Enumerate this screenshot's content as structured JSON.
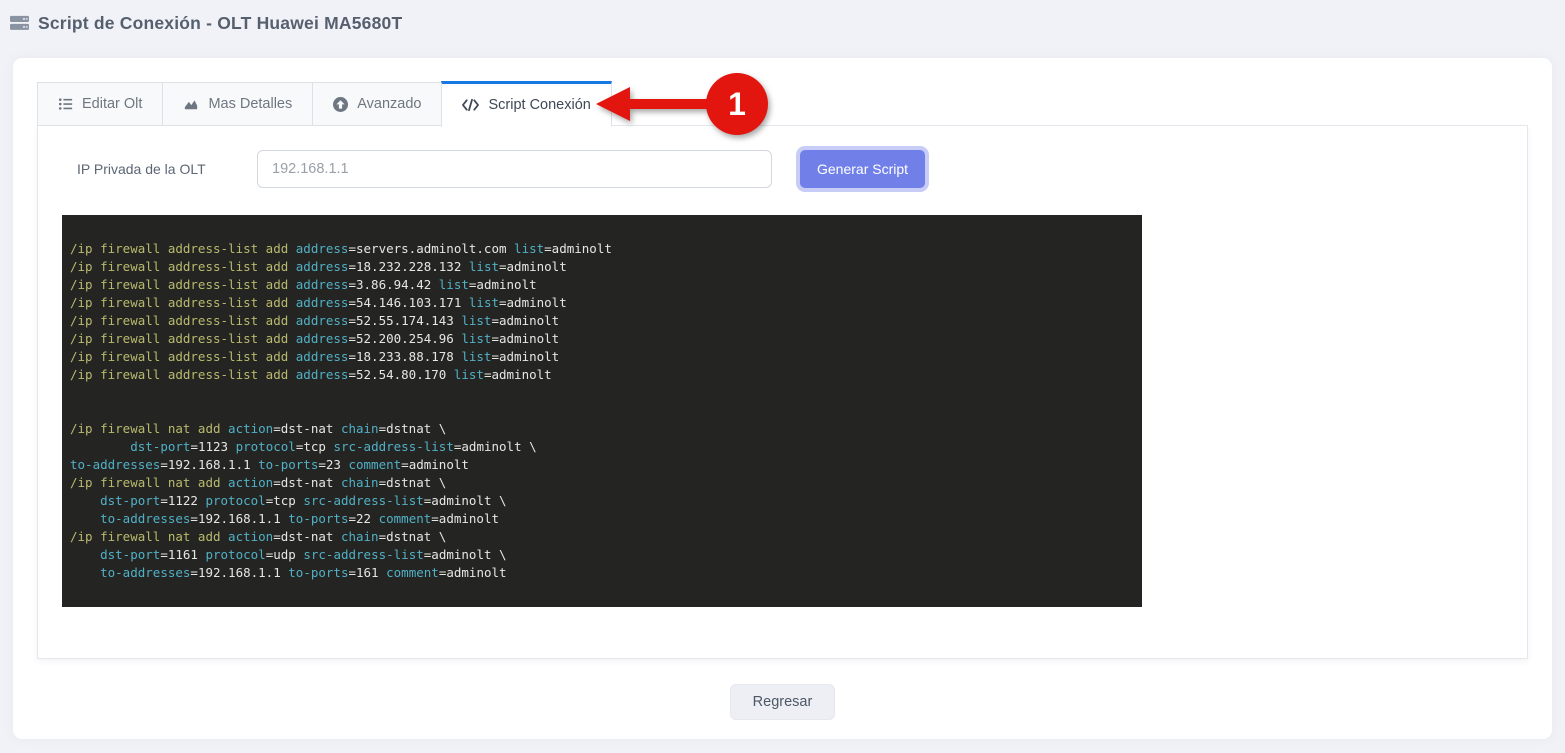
{
  "header": {
    "title": "Script de Conexión - OLT Huawei MA5680T",
    "icon": "server-icon"
  },
  "tabs": [
    {
      "label": "Editar Olt",
      "icon": "list-icon",
      "active": false
    },
    {
      "label": "Mas Detalles",
      "icon": "chart-area-icon",
      "active": false
    },
    {
      "label": "Avanzado",
      "icon": "arrow-up-circle-icon",
      "active": false
    },
    {
      "label": "Script Conexión",
      "icon": "code-icon",
      "active": true
    }
  ],
  "annotation": {
    "step_number": "1"
  },
  "form": {
    "ip_label": "IP Privada de la OLT",
    "ip_value": "192.168.1.1",
    "generate_button_label": "Generar Script"
  },
  "script_output": {
    "lines": [
      [
        [
          "cmd",
          "/ip firewall address-list add "
        ],
        [
          "key",
          "address"
        ],
        [
          "val",
          "=servers.adminolt.com "
        ],
        [
          "key",
          "list"
        ],
        [
          "val",
          "=adminolt"
        ]
      ],
      [
        [
          "cmd",
          "/ip firewall address-list add "
        ],
        [
          "key",
          "address"
        ],
        [
          "val",
          "=18.232.228.132 "
        ],
        [
          "key",
          "list"
        ],
        [
          "val",
          "=adminolt"
        ]
      ],
      [
        [
          "cmd",
          "/ip firewall address-list add "
        ],
        [
          "key",
          "address"
        ],
        [
          "val",
          "=3.86.94.42 "
        ],
        [
          "key",
          "list"
        ],
        [
          "val",
          "=adminolt"
        ]
      ],
      [
        [
          "cmd",
          "/ip firewall address-list add "
        ],
        [
          "key",
          "address"
        ],
        [
          "val",
          "=54.146.103.171 "
        ],
        [
          "key",
          "list"
        ],
        [
          "val",
          "=adminolt"
        ]
      ],
      [
        [
          "cmd",
          "/ip firewall address-list add "
        ],
        [
          "key",
          "address"
        ],
        [
          "val",
          "=52.55.174.143 "
        ],
        [
          "key",
          "list"
        ],
        [
          "val",
          "=adminolt"
        ]
      ],
      [
        [
          "cmd",
          "/ip firewall address-list add "
        ],
        [
          "key",
          "address"
        ],
        [
          "val",
          "=52.200.254.96 "
        ],
        [
          "key",
          "list"
        ],
        [
          "val",
          "=adminolt"
        ]
      ],
      [
        [
          "cmd",
          "/ip firewall address-list add "
        ],
        [
          "key",
          "address"
        ],
        [
          "val",
          "=18.233.88.178 "
        ],
        [
          "key",
          "list"
        ],
        [
          "val",
          "=adminolt"
        ]
      ],
      [
        [
          "cmd",
          "/ip firewall address-list add "
        ],
        [
          "key",
          "address"
        ],
        [
          "val",
          "=52.54.80.170 "
        ],
        [
          "key",
          "list"
        ],
        [
          "val",
          "=adminolt"
        ]
      ],
      [],
      [],
      [
        [
          "cmd",
          "/ip firewall nat add "
        ],
        [
          "key",
          "action"
        ],
        [
          "val",
          "=dst-nat "
        ],
        [
          "key",
          "chain"
        ],
        [
          "val",
          "=dstnat \\"
        ]
      ],
      [
        [
          "val",
          "        "
        ],
        [
          "key",
          "dst-port"
        ],
        [
          "val",
          "=1123 "
        ],
        [
          "key",
          "protocol"
        ],
        [
          "val",
          "=tcp "
        ],
        [
          "key",
          "src-address-list"
        ],
        [
          "val",
          "=adminolt \\"
        ]
      ],
      [
        [
          "key",
          "to-addresses"
        ],
        [
          "val",
          "=192.168.1.1 "
        ],
        [
          "key",
          "to-ports"
        ],
        [
          "val",
          "=23 "
        ],
        [
          "key",
          "comment"
        ],
        [
          "val",
          "=adminolt"
        ]
      ],
      [
        [
          "cmd",
          "/ip firewall nat add "
        ],
        [
          "key",
          "action"
        ],
        [
          "val",
          "=dst-nat "
        ],
        [
          "key",
          "chain"
        ],
        [
          "val",
          "=dstnat \\"
        ]
      ],
      [
        [
          "val",
          "    "
        ],
        [
          "key",
          "dst-port"
        ],
        [
          "val",
          "=1122 "
        ],
        [
          "key",
          "protocol"
        ],
        [
          "val",
          "=tcp "
        ],
        [
          "key",
          "src-address-list"
        ],
        [
          "val",
          "=adminolt \\"
        ]
      ],
      [
        [
          "val",
          "    "
        ],
        [
          "key",
          "to-addresses"
        ],
        [
          "val",
          "=192.168.1.1 "
        ],
        [
          "key",
          "to-ports"
        ],
        [
          "val",
          "=22 "
        ],
        [
          "key",
          "comment"
        ],
        [
          "val",
          "=adminolt"
        ]
      ],
      [
        [
          "cmd",
          "/ip firewall nat add "
        ],
        [
          "key",
          "action"
        ],
        [
          "val",
          "=dst-nat "
        ],
        [
          "key",
          "chain"
        ],
        [
          "val",
          "=dstnat \\"
        ]
      ],
      [
        [
          "val",
          "    "
        ],
        [
          "key",
          "dst-port"
        ],
        [
          "val",
          "=1161 "
        ],
        [
          "key",
          "protocol"
        ],
        [
          "val",
          "=udp "
        ],
        [
          "key",
          "src-address-list"
        ],
        [
          "val",
          "=adminolt \\"
        ]
      ],
      [
        [
          "val",
          "    "
        ],
        [
          "key",
          "to-addresses"
        ],
        [
          "val",
          "=192.168.1.1 "
        ],
        [
          "key",
          "to-ports"
        ],
        [
          "val",
          "=161 "
        ],
        [
          "key",
          "comment"
        ],
        [
          "val",
          "=adminolt"
        ]
      ]
    ]
  },
  "footer": {
    "back_button_label": "Regresar"
  },
  "colors": {
    "accent": "#1778e2",
    "btn": "#7180e9",
    "ring": "#c7cdf6",
    "red": "#e3150f",
    "code-bg": "#242522",
    "tok-cmd": "#b9ba6e",
    "tok-key": "#51b0c6",
    "tok-val": "#e6e6e3"
  }
}
